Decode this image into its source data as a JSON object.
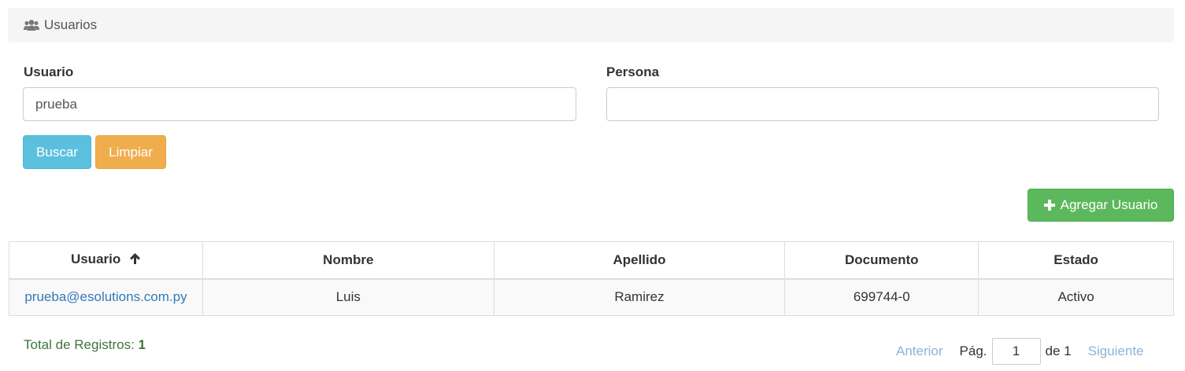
{
  "header": {
    "title": "Usuarios",
    "icon": "users-icon"
  },
  "filters": {
    "usuario_label": "Usuario",
    "usuario_value": "prueba",
    "persona_label": "Persona",
    "persona_value": ""
  },
  "actions": {
    "search_label": "Buscar",
    "clear_label": "Limpiar",
    "add_label": "Agregar Usuario"
  },
  "table": {
    "columns": [
      "Usuario",
      "Nombre",
      "Apellido",
      "Documento",
      "Estado"
    ],
    "sorted_column": "Usuario",
    "sort_direction": "ascending",
    "rows": [
      [
        "prueba@esolutions.com.py",
        "Luis",
        "Ramirez",
        "699744-0",
        "Activo"
      ]
    ]
  },
  "footer": {
    "total_label": "Total de Registros:",
    "total_value": "1"
  },
  "pagination": {
    "prev_label": "Anterior",
    "page_label": "Pág.",
    "page_value": "1",
    "of_label": "de 1",
    "next_label": "Siguiente"
  },
  "colors": {
    "info": "#5bc0de",
    "warning": "#f0ad4e",
    "success": "#5cb85c",
    "link": "#337ab7",
    "total_text": "#3c763d"
  }
}
